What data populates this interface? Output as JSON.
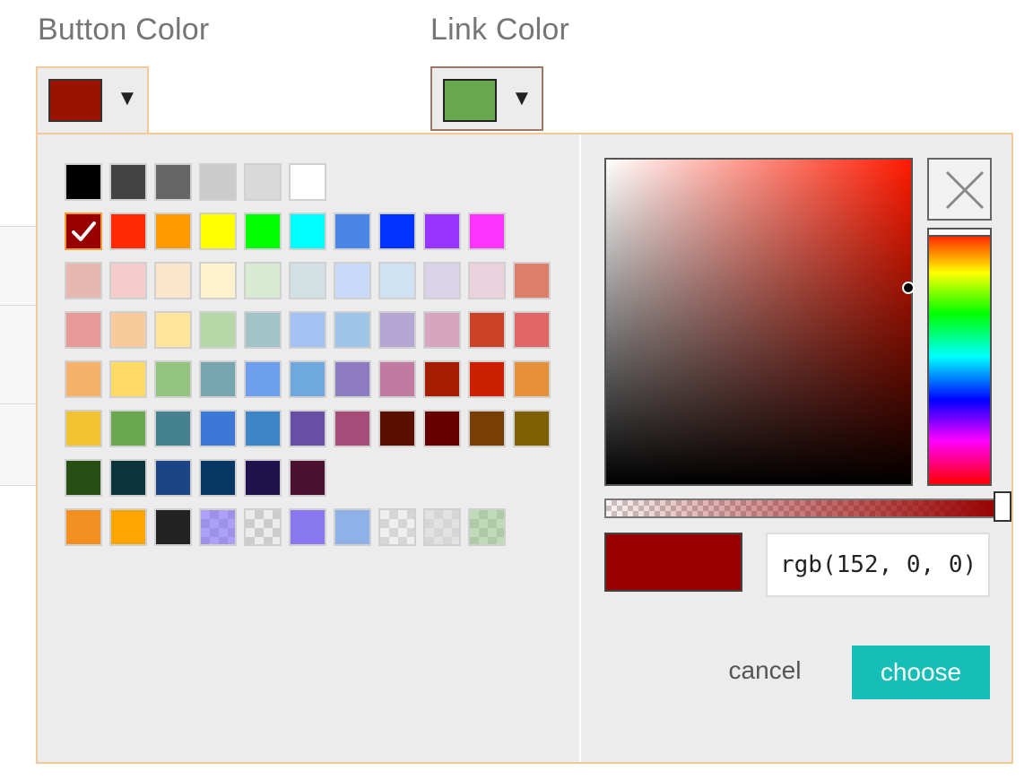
{
  "button_color": {
    "label": "Button Color",
    "swatch": "#9a1200",
    "dropdown_icon": "triangle-down-icon",
    "dropdown_glyph": "▼"
  },
  "link_color": {
    "label": "Link Color",
    "swatch": "#6aa84f",
    "dropdown_icon": "triangle-down-icon",
    "dropdown_glyph": "▼"
  },
  "palette": {
    "rows": [
      [
        {
          "color": "#000000"
        },
        {
          "color": "#434343"
        },
        {
          "color": "#666666"
        },
        {
          "color": "#cccccc"
        },
        {
          "color": "#d9d9d9"
        },
        {
          "color": "#ffffff"
        }
      ],
      [
        {
          "color": "#980000",
          "selected": true
        },
        {
          "color": "#ff2a00"
        },
        {
          "color": "#ff9900"
        },
        {
          "color": "#ffff00"
        },
        {
          "color": "#00ff00"
        },
        {
          "color": "#00ffff"
        },
        {
          "color": "#4a86e8"
        },
        {
          "color": "#0033ff"
        },
        {
          "color": "#9933ff"
        },
        {
          "color": "#ff33ff"
        }
      ],
      [
        {
          "color": "#e6b8af"
        },
        {
          "color": "#f4cccc"
        },
        {
          "color": "#fce5cd"
        },
        {
          "color": "#fff2cc"
        },
        {
          "color": "#d9ead3"
        },
        {
          "color": "#d0e0e3"
        },
        {
          "color": "#c9daf8"
        },
        {
          "color": "#cfe2f3"
        },
        {
          "color": "#d9d2e9"
        },
        {
          "color": "#ead1dc"
        },
        {
          "color": "#dd7e6b"
        }
      ],
      [
        {
          "color": "#ea9999"
        },
        {
          "color": "#f9cb9c"
        },
        {
          "color": "#ffe599"
        },
        {
          "color": "#b6d7a8"
        },
        {
          "color": "#a2c4c9"
        },
        {
          "color": "#a4c2f4"
        },
        {
          "color": "#9fc5e8"
        },
        {
          "color": "#b4a7d6"
        },
        {
          "color": "#d5a6bd"
        },
        {
          "color": "#cc4125"
        },
        {
          "color": "#e06666"
        }
      ],
      [
        {
          "color": "#f6b26b"
        },
        {
          "color": "#ffd966"
        },
        {
          "color": "#93c47d"
        },
        {
          "color": "#76a5af"
        },
        {
          "color": "#6d9eeb"
        },
        {
          "color": "#6fa8dc"
        },
        {
          "color": "#8e7cc3"
        },
        {
          "color": "#c27ba0"
        },
        {
          "color": "#a61c00"
        },
        {
          "color": "#cc1f00"
        },
        {
          "color": "#e69138"
        }
      ],
      [
        {
          "color": "#f1c232"
        },
        {
          "color": "#6aa84f"
        },
        {
          "color": "#45818e"
        },
        {
          "color": "#3c78d8"
        },
        {
          "color": "#3d85c6"
        },
        {
          "color": "#674ea7"
        },
        {
          "color": "#a64d79"
        },
        {
          "color": "#5b0f00"
        },
        {
          "color": "#660000"
        },
        {
          "color": "#783f04"
        },
        {
          "color": "#7f6000"
        }
      ],
      [
        {
          "color": "#274e13"
        },
        {
          "color": "#0c343d"
        },
        {
          "color": "#1c4587"
        },
        {
          "color": "#073763"
        },
        {
          "color": "#20124d"
        },
        {
          "color": "#4c1130"
        }
      ],
      [
        {
          "color": "#f39021"
        },
        {
          "color": "#ffa500"
        },
        {
          "color": "#222222"
        },
        {
          "color": "rgba(120,100,255,0.55)",
          "checker": true
        },
        {
          "color": "rgba(255,255,255,0)",
          "checker": true
        },
        {
          "color": "#8877ee"
        },
        {
          "color": "#8eb1e8"
        },
        {
          "color": "rgba(255,255,255,0.2)",
          "checker": true
        },
        {
          "color": "rgba(220,220,220,0.6)",
          "checker": true
        },
        {
          "color": "rgba(140,200,120,0.45)",
          "checker": true
        }
      ]
    ]
  },
  "picker": {
    "hue_color": "#ff1a00",
    "current_color": "#980000",
    "input_value": "rgb(152, 0, 0)",
    "clear_icon": "close-icon",
    "cancel_label": "cancel",
    "choose_label": "choose"
  }
}
